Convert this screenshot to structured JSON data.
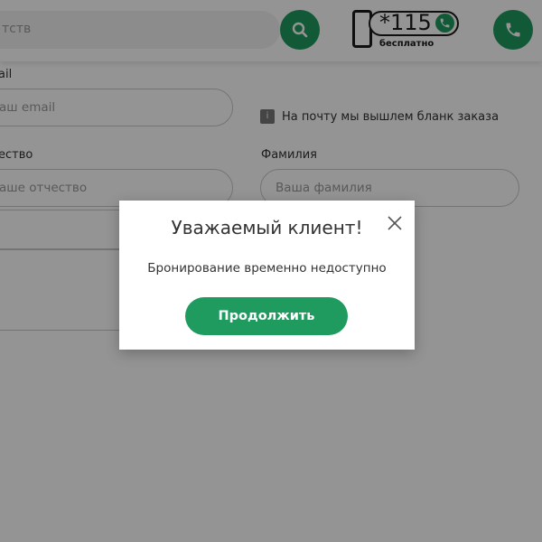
{
  "header": {
    "search_placeholder": "тств",
    "logo": {
      "number": "*115",
      "subtitle": "бесплатно"
    }
  },
  "form": {
    "email_label": "ail",
    "email_placeholder": "аш email",
    "hint_icon": "i",
    "hint_text": "На почту мы вышлем бланк заказа",
    "patronymic_label": "ество",
    "patronymic_placeholder": "аше отчество",
    "surname_label": "Фамилия",
    "surname_placeholder": "Ваша фамилия"
  },
  "modal": {
    "title": "Уважаемый клиент!",
    "message": "Бронирование временно недоступно",
    "button_label": "Продолжить"
  },
  "colors": {
    "accent": "#1f9b5f",
    "overlay": "rgba(0,0,0,0.42)"
  }
}
